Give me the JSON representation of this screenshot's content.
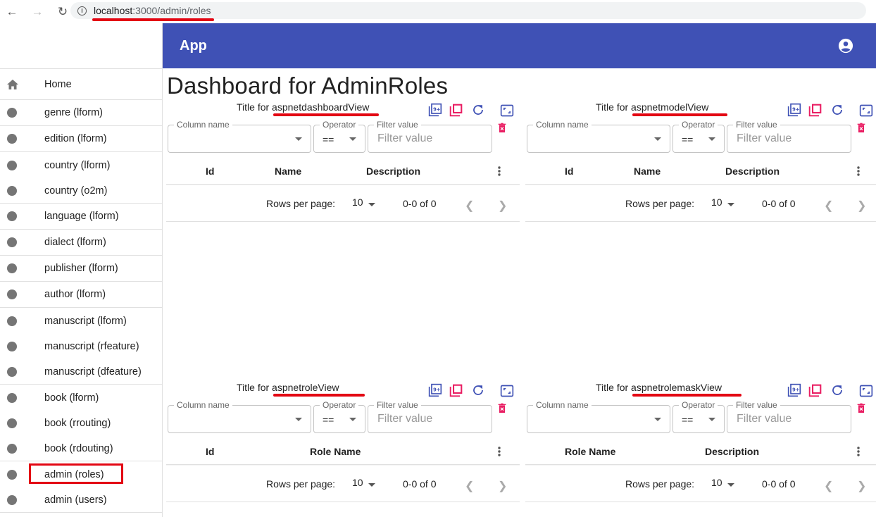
{
  "browser": {
    "back_icon": "arrow-left-icon",
    "forward_icon": "arrow-right-icon",
    "reload_icon": "reload-icon",
    "url_host": "localhost",
    "url_path": ":3000/admin/roles"
  },
  "appbar": {
    "title": "App",
    "account_icon": "account-circle-icon",
    "color": "#3f51b5"
  },
  "page": {
    "title": "Dashboard for AdminRoles"
  },
  "sidebar": {
    "items": [
      {
        "label": "Home",
        "icon": "home-icon"
      },
      {
        "label": "genre (lform)",
        "icon": "circle-icon"
      },
      {
        "label": "edition (lform)",
        "icon": "circle-icon"
      },
      {
        "label": "country (lform)",
        "icon": "circle-icon"
      },
      {
        "label": "country (o2m)",
        "icon": "circle-icon"
      },
      {
        "label": "language (lform)",
        "icon": "circle-icon"
      },
      {
        "label": "dialect (lform)",
        "icon": "circle-icon"
      },
      {
        "label": "publisher (lform)",
        "icon": "circle-icon"
      },
      {
        "label": "author (lform)",
        "icon": "circle-icon"
      },
      {
        "label": "manuscript (lform)",
        "icon": "circle-icon"
      },
      {
        "label": "manuscript (rfeature)",
        "icon": "circle-icon"
      },
      {
        "label": "manuscript (dfeature)",
        "icon": "circle-icon"
      },
      {
        "label": "book (lform)",
        "icon": "circle-icon"
      },
      {
        "label": "book (rrouting)",
        "icon": "circle-icon"
      },
      {
        "label": "book (rdouting)",
        "icon": "circle-icon"
      },
      {
        "label": "admin (roles)",
        "icon": "circle-icon",
        "selected": true
      },
      {
        "label": "admin (users)",
        "icon": "circle-icon"
      }
    ]
  },
  "filter": {
    "column_label": "Column name",
    "operator_label": "Operator",
    "operator_value": "==",
    "value_label": "Filter value",
    "value_placeholder": "Filter value"
  },
  "footer": {
    "rows_per_page_label": "Rows per page:",
    "rows_per_page_value": "10",
    "range": "0-0 of 0"
  },
  "panels": [
    {
      "title_prefix": "Title for ",
      "view_name": "aspnetdashboardView",
      "columns": [
        "Id",
        "Name",
        "Description"
      ]
    },
    {
      "title_prefix": "Title for ",
      "view_name": "aspnetmodelView",
      "columns": [
        "Id",
        "Name",
        "Description"
      ]
    },
    {
      "title_prefix": "Title for ",
      "view_name": "aspnetroleView",
      "columns": [
        "Id",
        "Role Name"
      ]
    },
    {
      "title_prefix": "Title for ",
      "view_name": "aspnetrolemaskView",
      "columns": [
        "Role Name",
        "Description"
      ]
    }
  ],
  "colors": {
    "icon_blue": "#3f51b5",
    "icon_pink": "#e91e63",
    "annotation_red": "#e30613"
  }
}
